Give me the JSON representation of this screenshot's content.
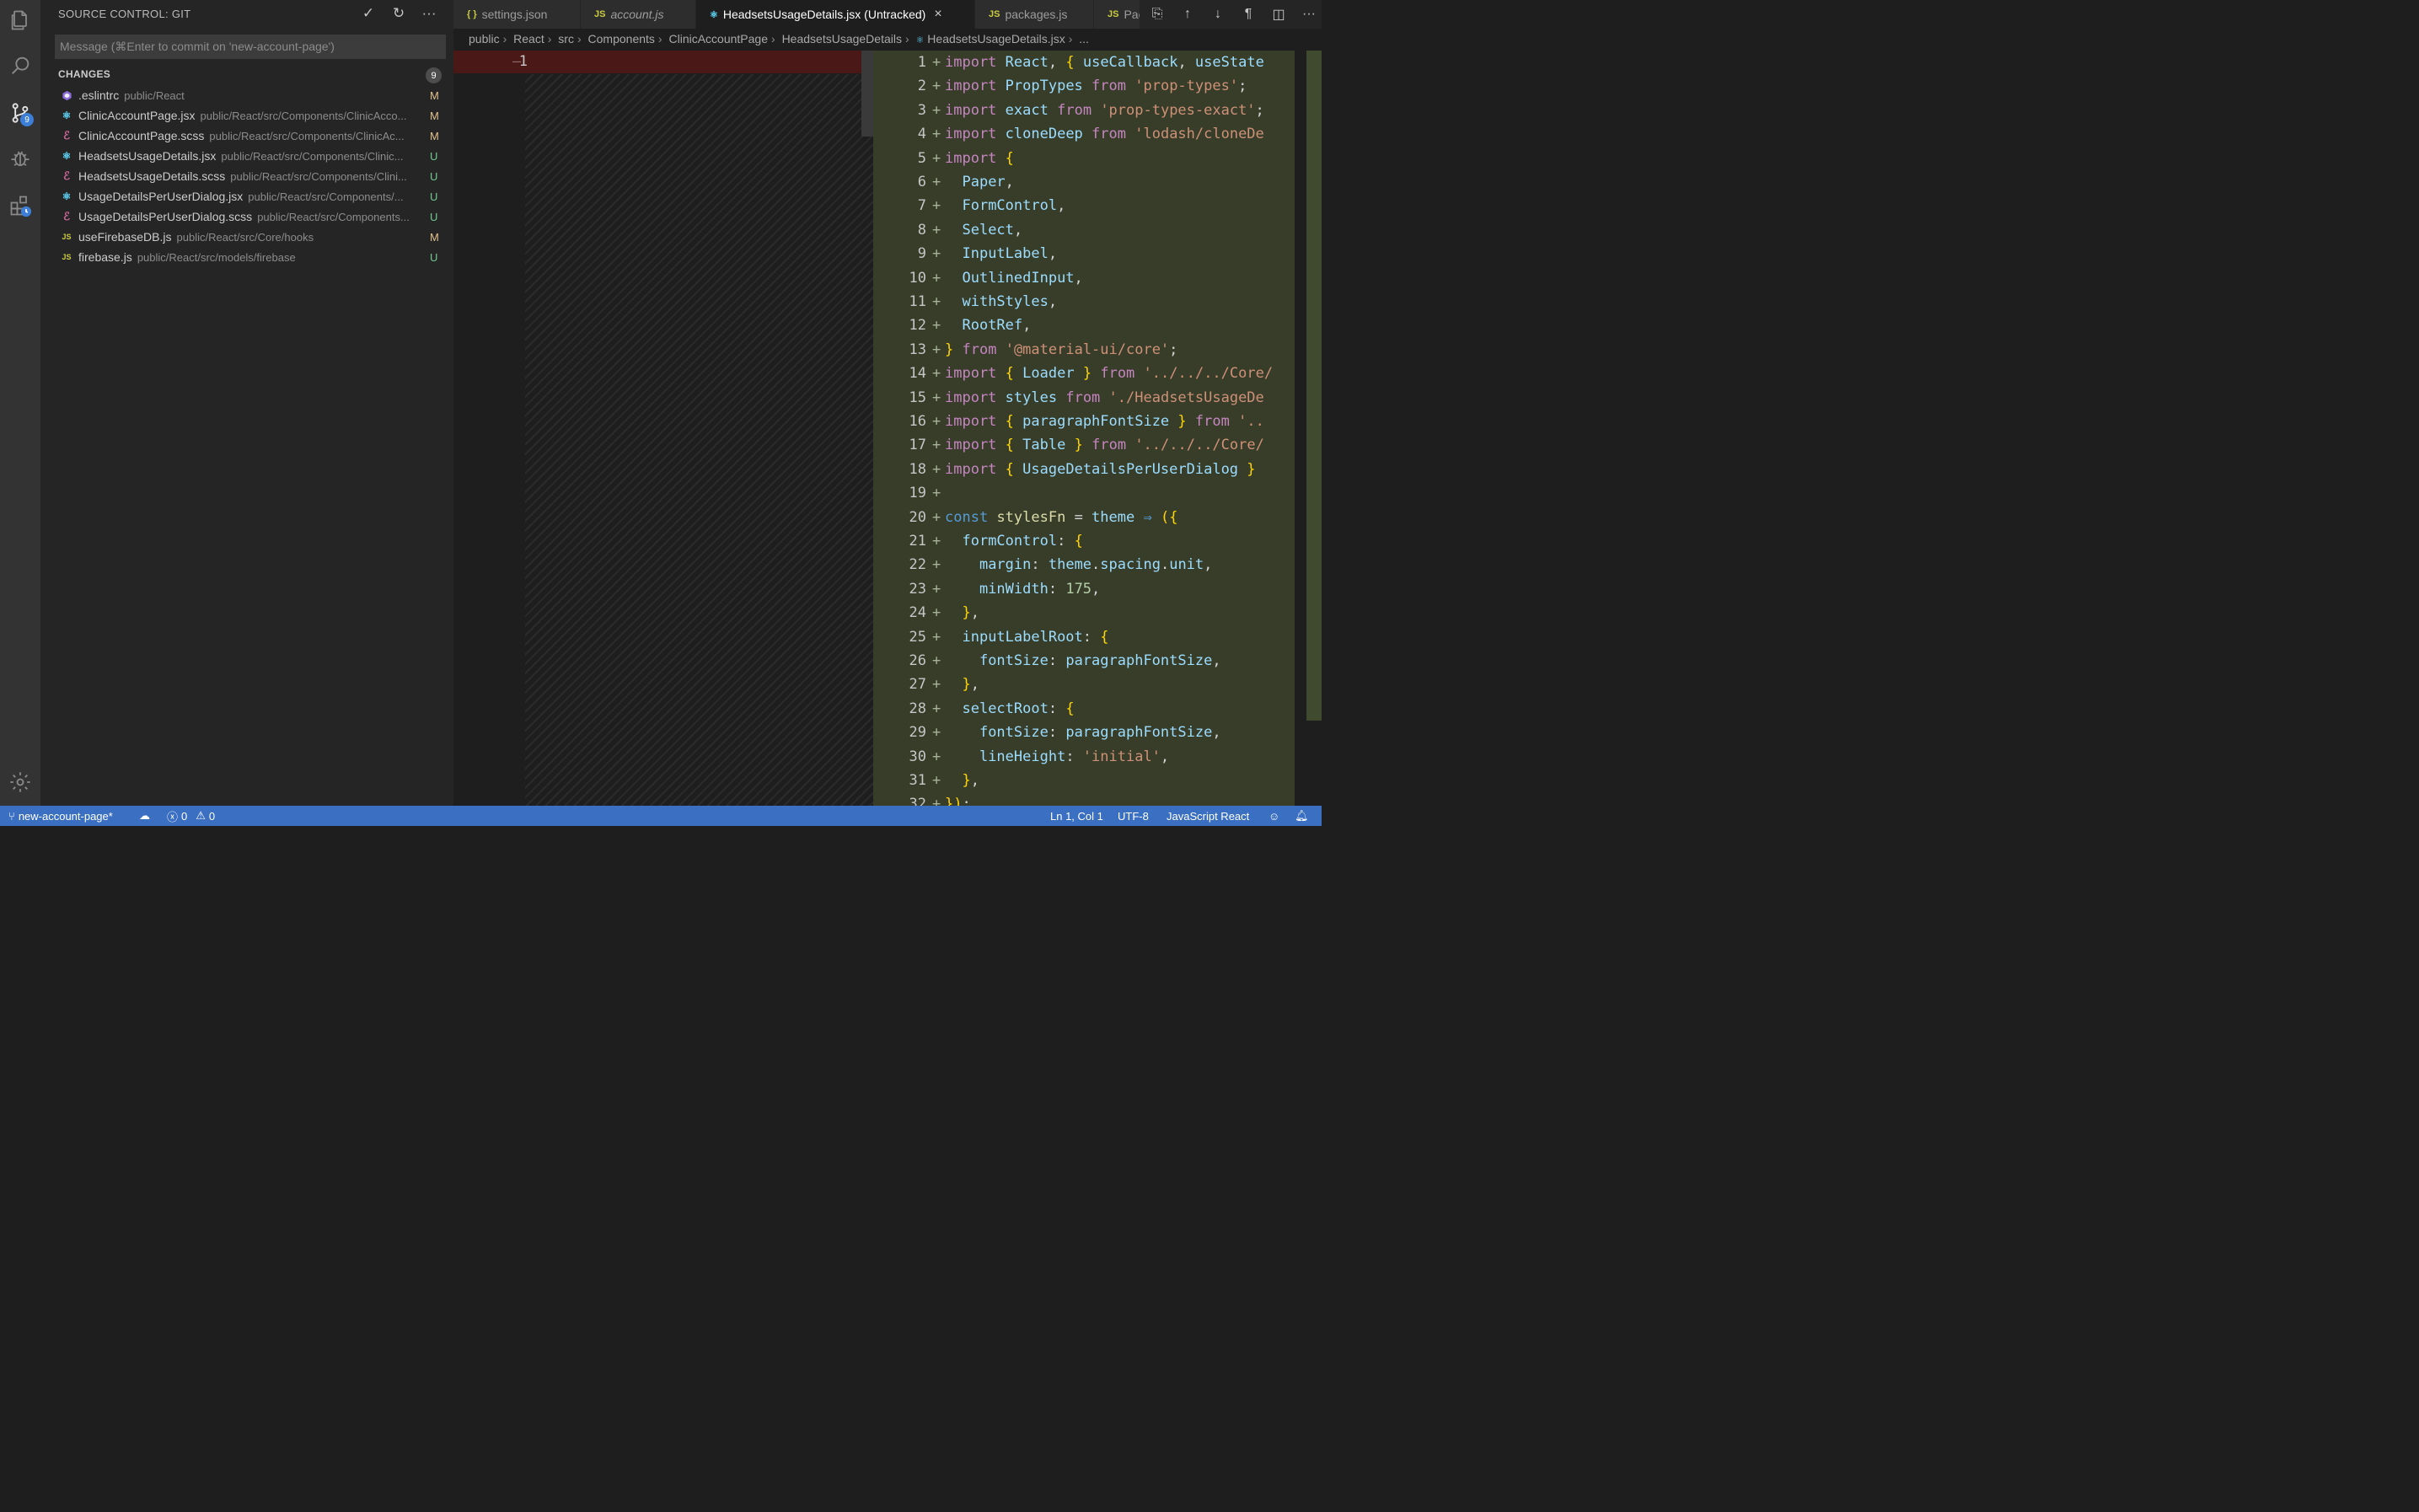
{
  "sidebar": {
    "title": "SOURCE CONTROL: GIT",
    "message_placeholder": "Message (⌘Enter to commit on 'new-account-page')",
    "changes_label": "CHANGES",
    "changes_count": "9",
    "files": [
      {
        "name": ".eslintrc",
        "path": "public/React",
        "status": "M",
        "icon": "eslint-icon"
      },
      {
        "name": "ClinicAccountPage.jsx",
        "path": "public/React/src/Components/ClinicAcco...",
        "status": "M",
        "icon": "react-icon"
      },
      {
        "name": "ClinicAccountPage.scss",
        "path": "public/React/src/Components/ClinicAc...",
        "status": "M",
        "icon": "sass-icon"
      },
      {
        "name": "HeadsetsUsageDetails.jsx",
        "path": "public/React/src/Components/Clinic...",
        "status": "U",
        "icon": "react-icon"
      },
      {
        "name": "HeadsetsUsageDetails.scss",
        "path": "public/React/src/Components/Clini...",
        "status": "U",
        "icon": "sass-icon"
      },
      {
        "name": "UsageDetailsPerUserDialog.jsx",
        "path": "public/React/src/Components/...",
        "status": "U",
        "icon": "react-icon"
      },
      {
        "name": "UsageDetailsPerUserDialog.scss",
        "path": "public/React/src/Components...",
        "status": "U",
        "icon": "sass-icon"
      },
      {
        "name": "useFirebaseDB.js",
        "path": "public/React/src/Core/hooks",
        "status": "M",
        "icon": "js-icon"
      },
      {
        "name": "firebase.js",
        "path": "public/React/src/models/firebase",
        "status": "U",
        "icon": "js-icon"
      }
    ]
  },
  "activity": {
    "scm_badge": "9"
  },
  "tabs": [
    {
      "label": "settings.json",
      "icon": "{}",
      "italic": false
    },
    {
      "label": "account.js",
      "icon": "JS",
      "italic": true
    },
    {
      "label": "HeadsetsUsageDetails.jsx (Untracked)",
      "icon": "react",
      "italic": false
    },
    {
      "label": "packages.js",
      "icon": "JS",
      "italic": false
    },
    {
      "label": "Pacl",
      "icon": "JS",
      "italic": false
    }
  ],
  "breadcrumbs": [
    "public",
    "React",
    "src",
    "Components",
    "ClinicAccountPage",
    "HeadsetsUsageDetails",
    "HeadsetsUsageDetails.jsx",
    "..."
  ],
  "left_pane": {
    "line_number": "1",
    "marker": "–"
  },
  "code_lines": [
    "import React, { useCallback, useState",
    "import PropTypes from 'prop-types';",
    "import exact from 'prop-types-exact';",
    "import cloneDeep from 'lodash/cloneDe",
    "import {",
    "  Paper,",
    "  FormControl,",
    "  Select,",
    "  InputLabel,",
    "  OutlinedInput,",
    "  withStyles,",
    "  RootRef,",
    "} from '@material-ui/core';",
    "import { Loader } from '../../../Core/",
    "import styles from './HeadsetsUsageDe",
    "import { paragraphFontSize } from '..",
    "import { Table } from '../../../Core/",
    "import { UsageDetailsPerUserDialog }",
    "",
    "const stylesFn = theme ⇒ ({",
    "  formControl: {",
    "    margin: theme.spacing.unit,",
    "    minWidth: 175,",
    "  },",
    "  inputLabelRoot: {",
    "    fontSize: paragraphFontSize,",
    "  },",
    "  selectRoot: {",
    "    fontSize: paragraphFontSize,",
    "    lineHeight: 'initial',",
    "  },",
    "});"
  ],
  "status_bar": {
    "branch": "new-account-page*",
    "errors": "0",
    "warnings": "0",
    "position": "Ln 1, Col 1",
    "encoding": "UTF-8",
    "language": "JavaScript React"
  },
  "colors": {
    "status_bar": "#3a6fc2",
    "added_bg": "#373d29",
    "removed_bg": "#4b1818",
    "modified": "#e2c08d",
    "untracked": "#73c991"
  }
}
